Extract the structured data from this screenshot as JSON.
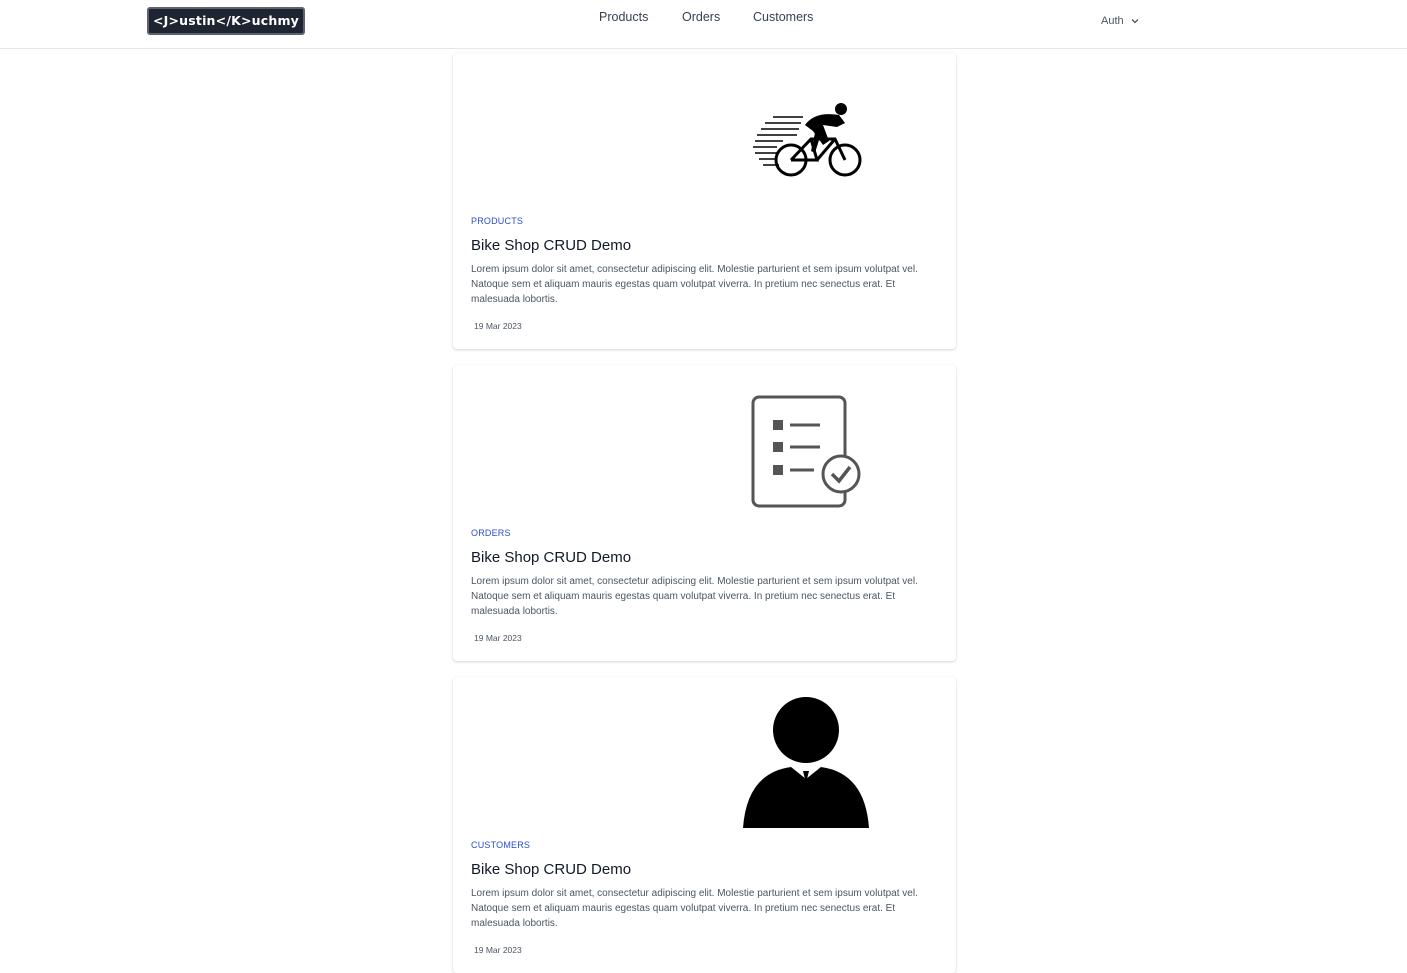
{
  "header": {
    "logo_text": "<J>ustin</K>uchmy",
    "nav": [
      "Products",
      "Orders",
      "Customers"
    ],
    "auth_label": "Auth"
  },
  "cards": [
    {
      "icon": "cyclist-icon",
      "tag": "PRODUCTS",
      "title": "Bike Shop CRUD Demo",
      "description": "Lorem ipsum dolor sit amet, consectetur adipiscing elit. Molestie parturient et sem ipsum volutpat vel. Natoque sem et aliquam mauris egestas quam volutpat viverra. In pretium nec senectus erat. Et malesuada lobortis.",
      "date": "19 Mar 2023"
    },
    {
      "icon": "checklist-icon",
      "tag": "ORDERS",
      "title": "Bike Shop CRUD Demo",
      "description": "Lorem ipsum dolor sit amet, consectetur adipiscing elit. Molestie parturient et sem ipsum volutpat vel. Natoque sem et aliquam mauris egestas quam volutpat viverra. In pretium nec senectus erat. Et malesuada lobortis.",
      "date": "19 Mar 2023"
    },
    {
      "icon": "person-icon",
      "tag": "CUSTOMERS",
      "title": "Bike Shop CRUD Demo",
      "description": "Lorem ipsum dolor sit amet, consectetur adipiscing elit. Molestie parturient et sem ipsum volutpat vel. Natoque sem et aliquam mauris egestas quam volutpat viverra. In pretium nec senectus erat. Et malesuada lobortis.",
      "date": "19 Mar 2023"
    }
  ],
  "colors": {
    "accent": "#2b4ecb",
    "logo_bg": "#1f2433"
  }
}
